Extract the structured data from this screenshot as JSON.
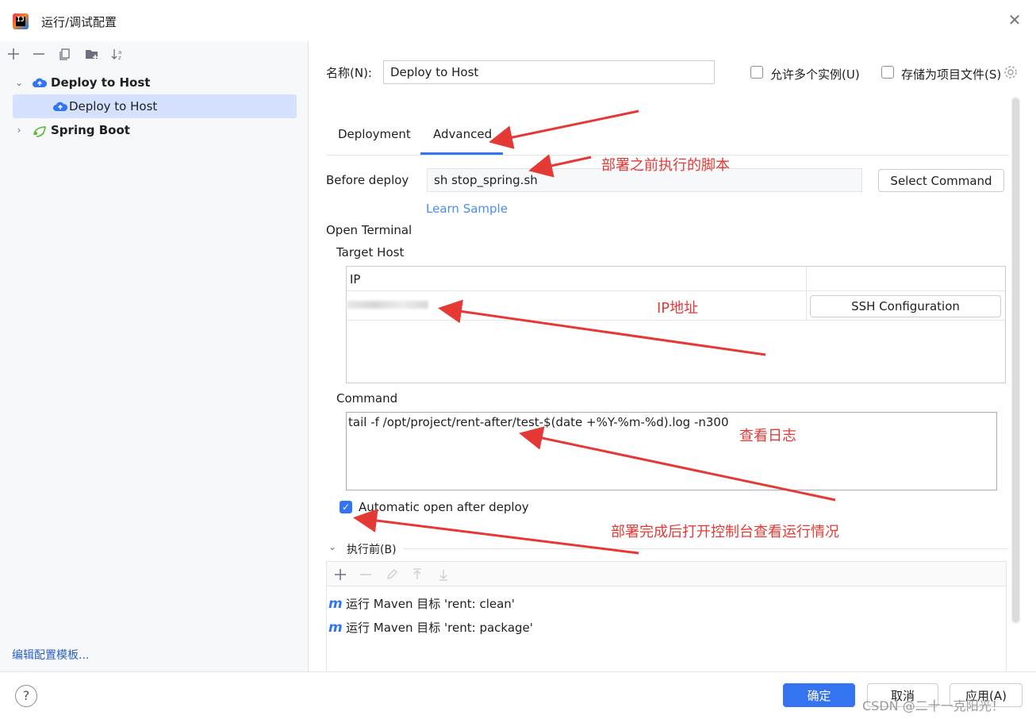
{
  "window": {
    "title": "运行/调试配置",
    "app_icon_text": "IJ"
  },
  "sidebar": {
    "tree": [
      {
        "label": "Deploy to Host",
        "expanded": true,
        "bold": true
      },
      {
        "label": "Deploy to Host",
        "selected": true
      },
      {
        "label": "Spring Boot",
        "expanded": false,
        "bold": true
      }
    ],
    "template_link": "编辑配置模板..."
  },
  "form": {
    "name_label": "名称(N):",
    "name_value": "Deploy to Host",
    "allow_multiple_label": "允许多个实例(U)",
    "store_as_project_label": "存储为项目文件(S)"
  },
  "tabs": [
    {
      "label": "Deployment",
      "active": false
    },
    {
      "label": "Advanced",
      "active": true
    }
  ],
  "advanced": {
    "before_deploy_label": "Before deploy",
    "before_deploy_value": "sh stop_spring.sh",
    "select_command_label": "Select Command",
    "learn_sample_label": "Learn Sample",
    "open_terminal_label": "Open Terminal",
    "target_host_label": "Target Host",
    "ip_header": "IP",
    "ssh_config_label": "SSH Configuration",
    "command_label": "Command",
    "command_value": "tail -f /opt/project/rent-after/test-$(date +%Y-%m-%d).log -n300",
    "auto_open_label": "Automatic open after deploy",
    "auto_open_checked": true
  },
  "before_launch": {
    "section_label": "执行前(B)",
    "items": [
      {
        "icon": "maven-icon",
        "text": "运行 Maven 目标 'rent: clean'"
      },
      {
        "icon": "maven-icon",
        "text": "运行 Maven 目标 'rent: package'"
      }
    ]
  },
  "annotations": {
    "script_note": "部署之前执行的脚本",
    "ip_note": "IP地址",
    "log_note": "查看日志",
    "console_note": "部署完成后打开控制台查看运行情况"
  },
  "footer": {
    "ok_label": "确定",
    "cancel_label": "取消",
    "apply_label": "应用(A)",
    "help_label": "?"
  },
  "watermark": "CSDN @二十一克阳光！",
  "colors": {
    "accent": "#3574f0",
    "annotation": "#e53935",
    "selection": "#d5e1ff",
    "link": "#4a8fe8"
  }
}
